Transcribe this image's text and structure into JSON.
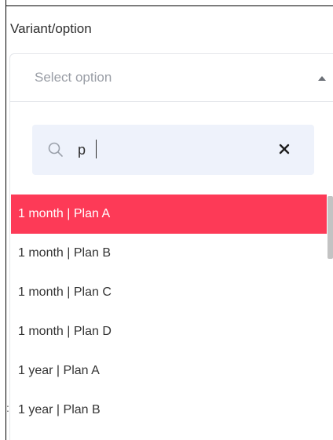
{
  "field": {
    "label": "Variant/option"
  },
  "select": {
    "placeholder": "Select option",
    "expanded": true,
    "caret_icon": "caret-up-icon"
  },
  "search": {
    "value": "p",
    "search_icon": "search-icon",
    "clear_icon": "close-icon",
    "background": "#eef2fb"
  },
  "options": [
    {
      "label": "1 month | Plan A"
    },
    {
      "label": "1 month | Plan B"
    },
    {
      "label": "1 month | Plan C"
    },
    {
      "label": "1 month | Plan D"
    },
    {
      "label": "1 year | Plan A"
    },
    {
      "label": "1 year | Plan B"
    }
  ],
  "highlighted_option": "1 month | Plan A",
  "colors": {
    "highlight": "#fd3a57",
    "placeholder_text": "#9a9ea6",
    "text": "#333333"
  },
  "stray_mark": ":"
}
